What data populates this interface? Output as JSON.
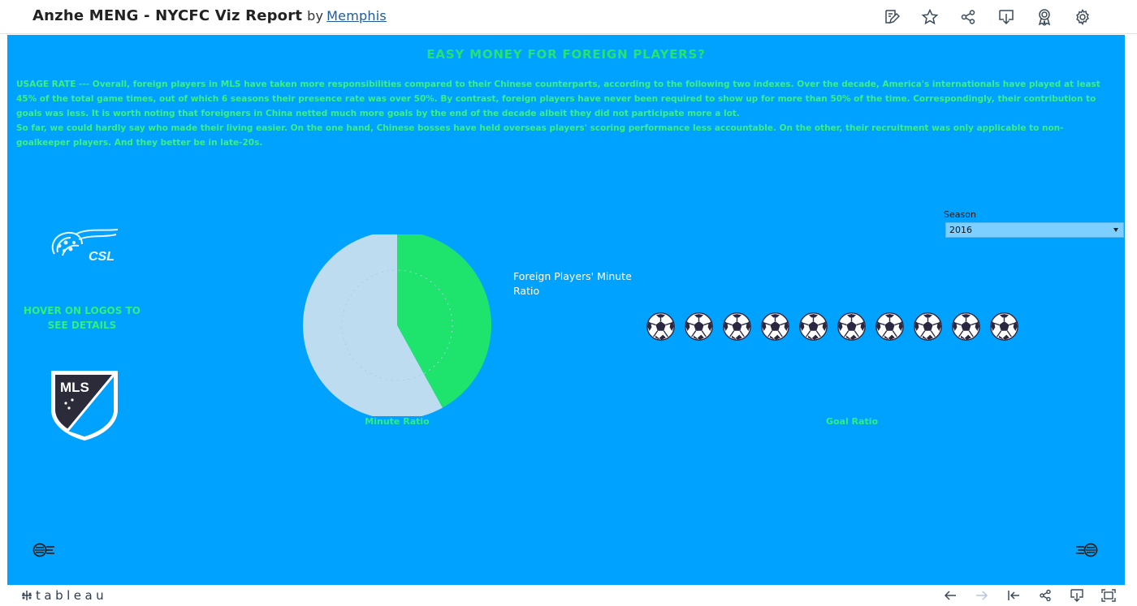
{
  "header": {
    "title": "Anzhe MENG - NYCFC Viz Report",
    "by": "by",
    "author": "Memphis",
    "icons": [
      "edit-icon",
      "star-icon",
      "share-icon",
      "download-icon",
      "badge-icon",
      "settings-icon"
    ]
  },
  "dashboard": {
    "headline": "EASY MONEY FOR FOREIGN PLAYERS?",
    "paragraph1": "USAGE RATE --- Overall, foreign players in MLS have taken more responsibilities compared to their Chinese counterparts, according to the following two indexes. Over the decade, America's internationals have played at least 45% of the total game times, out of which 6 seasons their presence rate was over 50%. By contrast, foreign players have never been required to show up for more than 50% of the time. Correspondingly, their contribution to goals was less. It is worth noting that foreigners in China netted much more goals by the end of the decade albeit they did not participate more a lot.",
    "paragraph2": "So far, we could hardly say who made their living easier. On the one hand, Chinese bosses have held overseas players' scoring performance less accountable. On the other, their recruitment was only applicable to non-goalkeeper players. And they better be in late-20s.",
    "csl_logo_text": "CSL",
    "mls_logo_text": "MLS",
    "hover_hint": "HOVER ON LOGOS TO SEE DETAILS",
    "minute_caption": "Minute Ratio",
    "legend_title": "Foreign Players' Minute Ratio",
    "goal_caption": "Goal Ratio",
    "season_filter": {
      "label": "Season",
      "selected": "2016"
    },
    "colors": {
      "background": "#00a2ff",
      "accent_green": "#26e36f",
      "pie_light": "#bddcf0"
    }
  },
  "chart_data": [
    {
      "type": "pie",
      "title": "Minute Ratio",
      "series": [
        {
          "values": [
            0.42,
            0.58
          ],
          "colors": [
            "#1ee36d",
            "#bddcf0"
          ]
        }
      ]
    },
    {
      "type": "pictogram",
      "title": "Goal Ratio",
      "icon": "soccer-ball-icon",
      "count": 10,
      "values": [
        10
      ]
    }
  ],
  "footer": {
    "brand": "tableau",
    "icons": [
      "undo-icon",
      "redo-icon",
      "revert-icon",
      "share-icon",
      "download-icon",
      "fullscreen-icon"
    ]
  }
}
